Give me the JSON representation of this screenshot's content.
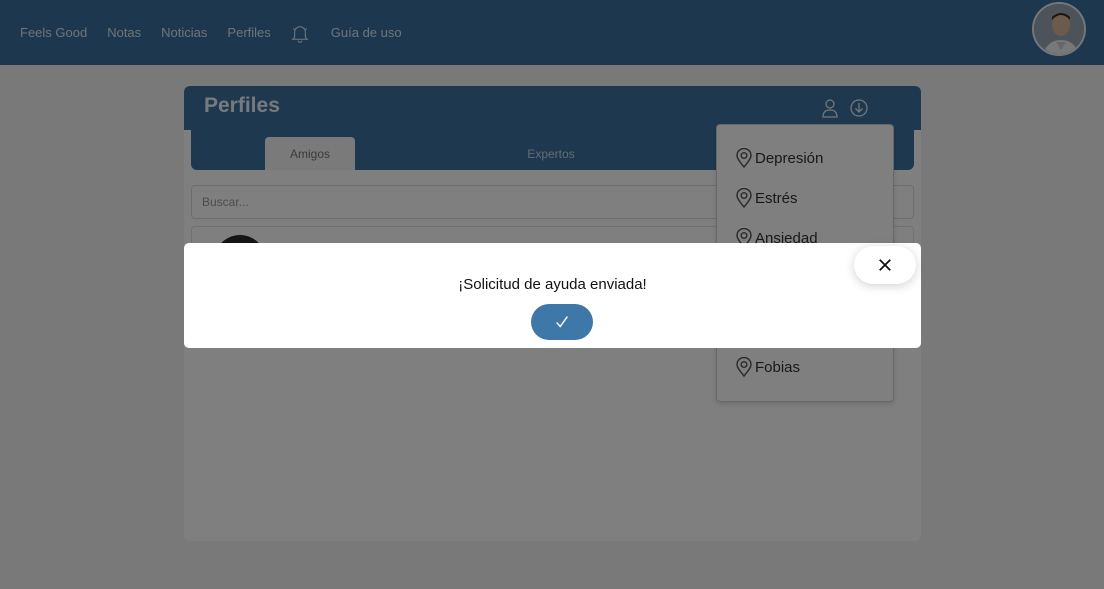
{
  "navbar": {
    "brand": "Feels Good",
    "links": [
      "Notas",
      "Noticias",
      "Perfiles"
    ],
    "guide": "Guía de uso",
    "bell_icon": "bell-icon",
    "avatar_icon": "user-avatar"
  },
  "panel": {
    "title": "Perfiles",
    "tabs": [
      {
        "label": "Amigos",
        "active": true
      },
      {
        "label": "Expertos",
        "active": false
      }
    ],
    "search_placeholder": "Buscar..."
  },
  "dropdown": {
    "items": [
      "Depresión",
      "Estrés",
      "Ansiedad",
      "Fobias"
    ]
  },
  "modal": {
    "message": "¡Solicitud de ayuda enviada!",
    "confirm_icon": "check-icon",
    "close_icon": "close-icon"
  },
  "colors": {
    "primary": "#3d739f",
    "confirm": "#3d78a8",
    "overlay": "rgba(0,0,0,0.5)"
  }
}
